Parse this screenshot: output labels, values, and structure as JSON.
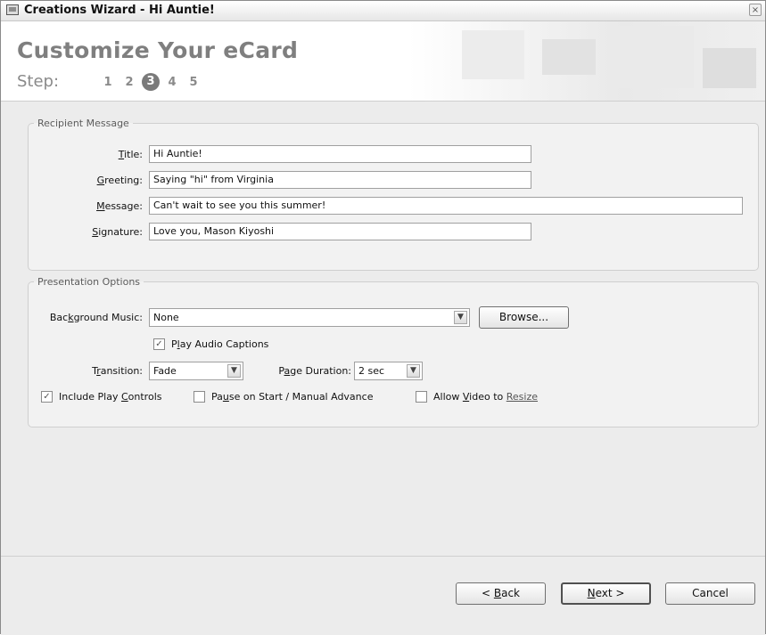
{
  "window": {
    "title": "Creations Wizard - Hi Auntie!",
    "close_label": "×"
  },
  "header": {
    "title": "Customize Your eCard",
    "step_label": "Step:",
    "steps": [
      "1",
      "2",
      "3",
      "4",
      "5"
    ],
    "current_step": 3
  },
  "recipient": {
    "legend": "Recipient Message",
    "title_label": "itle:",
    "title_mnemonic": "T",
    "title_value": "Hi Auntie!",
    "greeting_label": "reeting:",
    "greeting_mnemonic": "G",
    "greeting_value": "Saying \"hi\" from Virginia",
    "message_label": "essage:",
    "message_mnemonic": "M",
    "message_value": "Can't wait to see you this summer!",
    "signature_label": "ignature:",
    "signature_mnemonic": "S",
    "signature_value": "Love you, Mason Kiyoshi"
  },
  "presentation": {
    "legend": "Presentation Options",
    "music_label_pre": "Bac",
    "music_label_mn": "k",
    "music_label_post": "ground Music:",
    "music_value": "None",
    "browse_label": "Browse...",
    "play_captions_pre": "P",
    "play_captions_mn": "l",
    "play_captions_post": "ay Audio Captions",
    "play_captions_checked": true,
    "transition_pre": "T",
    "transition_mn": "r",
    "transition_post": "ansition:",
    "transition_value": "Fade",
    "duration_pre": "P",
    "duration_mn": "a",
    "duration_post": "ge Duration:",
    "duration_value": "2 sec",
    "include_controls_pre": "Include Play ",
    "include_controls_mn": "C",
    "include_controls_post": "ontrols",
    "include_controls_checked": true,
    "pause_pre": "Pa",
    "pause_mn": "u",
    "pause_post": "se on Start / Manual Advance",
    "pause_checked": false,
    "allow_pre": "Allow ",
    "allow_mn": "V",
    "allow_post": "ideo to ",
    "allow_link": "Resize",
    "allow_checked": false
  },
  "footer": {
    "back_label": "< ",
    "back_mn": "B",
    "back_post": "ack",
    "next_mn": "N",
    "next_post": "ext >",
    "cancel_label": "Cancel"
  }
}
